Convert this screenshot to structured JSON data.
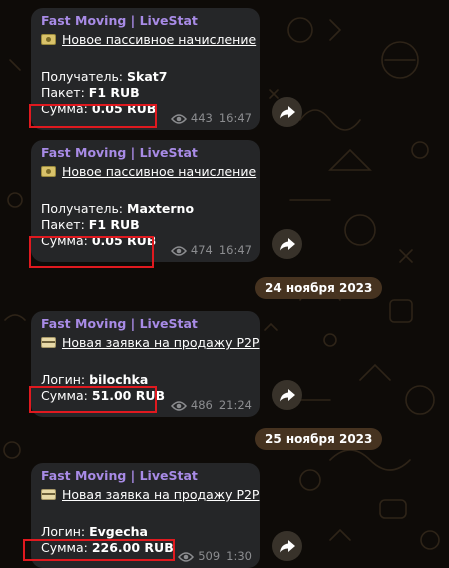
{
  "messages": [
    {
      "channel": "Fast Moving | LiveStat",
      "emoji": "money-icon",
      "title": "Новое пассивное начисление",
      "line1_label": "Получатель: ",
      "line1_value": "Skat7",
      "line2_label": "Пакет: ",
      "line2_value": "F1 RUB",
      "sum_label": "Сумма: ",
      "sum_value": "0.05 RUB",
      "views": "443",
      "time": "16:47"
    },
    {
      "channel": "Fast Moving | LiveStat",
      "emoji": "money-icon",
      "title": "Новое пассивное начисление",
      "line1_label": "Получатель: ",
      "line1_value": "Maxterno",
      "line2_label": "Пакет: ",
      "line2_value": "F1 RUB",
      "sum_label": "Сумма: ",
      "sum_value": "0.05 RUB",
      "views": "474",
      "time": "16:47"
    },
    {
      "channel": "Fast Moving | LiveStat",
      "emoji": "credit-card-icon",
      "title": "Новая заявка на продажу P2P",
      "line1_label": "Логин: ",
      "line1_value": "bilochka",
      "sum_label": "Сумма: ",
      "sum_value": "51.00 RUB",
      "views": "486",
      "time": "21:24"
    },
    {
      "channel": "Fast Moving | LiveStat",
      "emoji": "credit-card-icon",
      "title": "Новая заявка на продажу P2P",
      "line1_label": "Логин: ",
      "line1_value": "Evgecha",
      "sum_label": "Сумма: ",
      "sum_value": "226.00 RUB",
      "views": "509",
      "time": "1:30"
    }
  ],
  "dates": [
    "24 ноября 2023",
    "25 ноября 2023"
  ],
  "colors": {
    "channel": "#a88be6",
    "bubble": "#252628",
    "highlight": "#e0191f",
    "meta": "#8c8d90"
  }
}
